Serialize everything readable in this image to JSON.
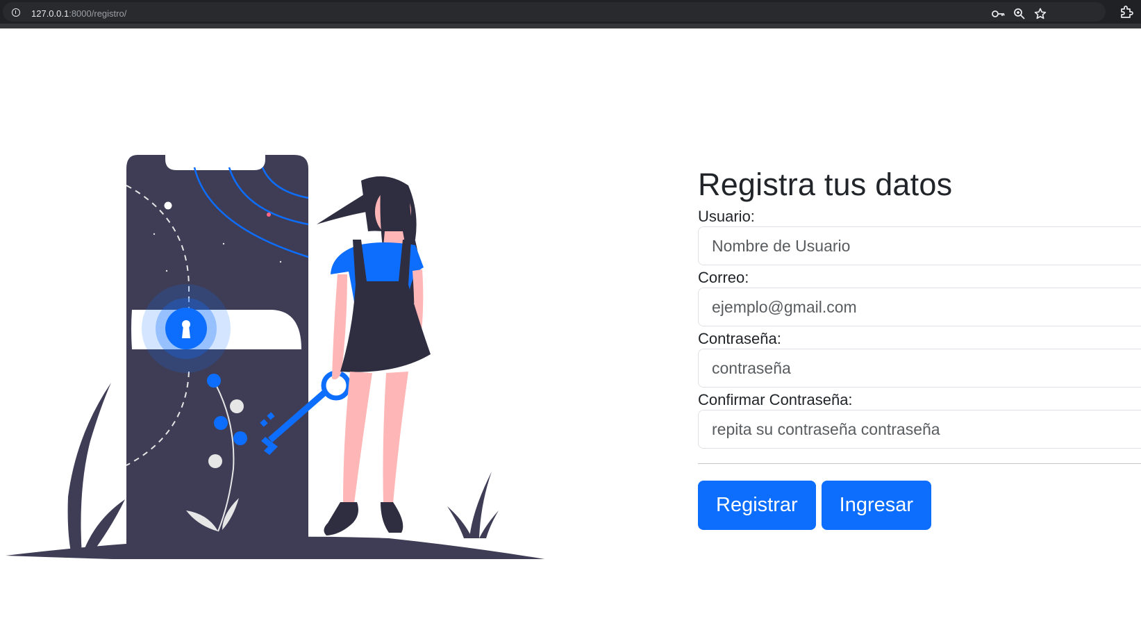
{
  "browser": {
    "url_host": "127.0.0.1",
    "url_path": ":8000/registro/",
    "icons": [
      "info-icon",
      "password-key-icon",
      "zoom-icon",
      "bookmark-star-icon",
      "extensions-icon"
    ]
  },
  "illustration": {
    "description_icons": [
      "phone-icon",
      "lock-icon",
      "key-icon",
      "woman-figure",
      "plant-icon"
    ]
  },
  "form": {
    "title": "Registra tus datos",
    "fields": [
      {
        "label": "Usuario:",
        "placeholder": "Nombre de Usuario",
        "value": ""
      },
      {
        "label": "Correo:",
        "placeholder": "ejemplo@gmail.com",
        "value": ""
      },
      {
        "label": "Contraseña:",
        "placeholder": "contraseña",
        "value": ""
      },
      {
        "label": "Confirmar Contraseña:",
        "placeholder": "repita su contraseña contraseña",
        "value": ""
      }
    ],
    "buttons": {
      "register_label": "Registrar",
      "login_label": "Ingresar"
    }
  },
  "colors": {
    "accent": "#0d6efd",
    "dark": "#3f3d56",
    "skin": "#ffb6b6",
    "page_bg": "#ffffff"
  }
}
